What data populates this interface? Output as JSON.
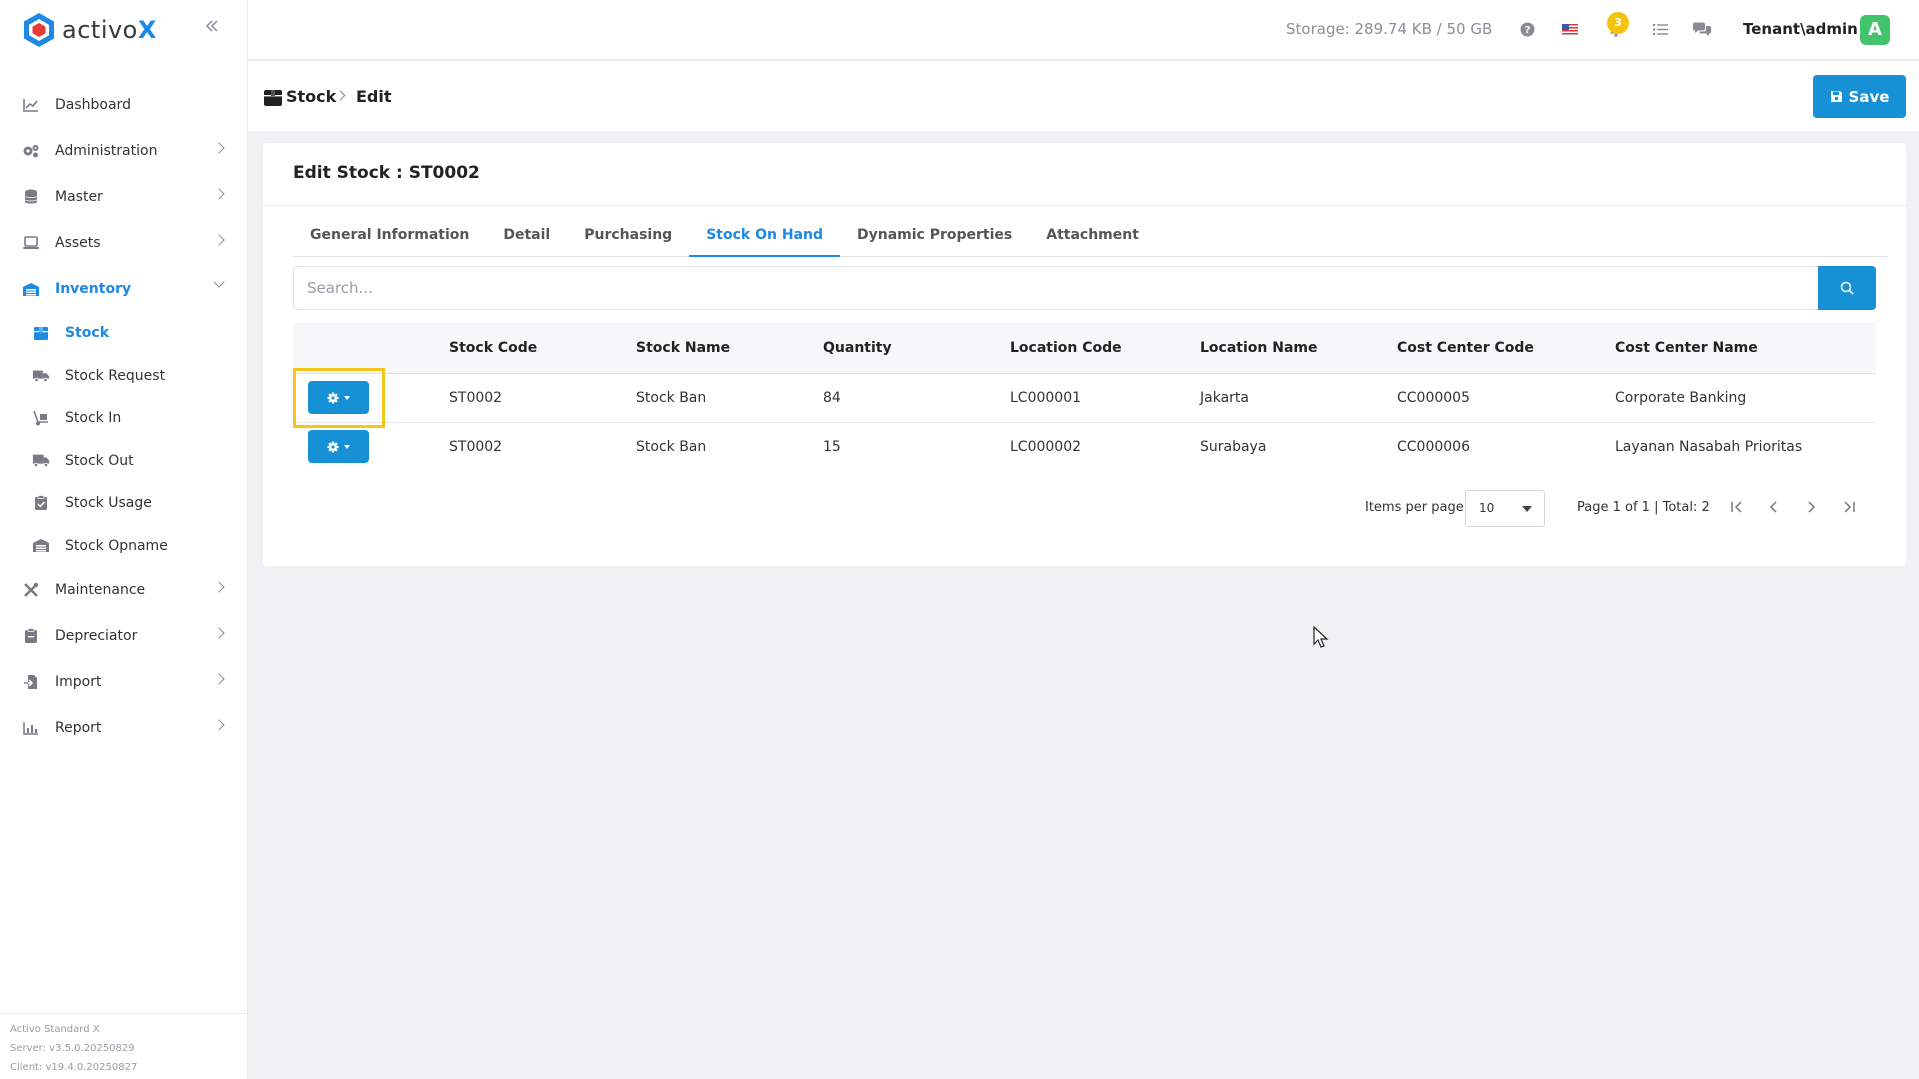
{
  "app": {
    "logo_text_main": "activo",
    "logo_text_accent": "X",
    "footer": {
      "product": "Activo Standard X",
      "server": "Server: v3.5.0.20250829",
      "client": "Client: v19.4.0.20250827"
    }
  },
  "sidebar": {
    "items": [
      {
        "label": "Dashboard",
        "icon": "chart-line-icon"
      },
      {
        "label": "Administration",
        "icon": "gears-icon"
      },
      {
        "label": "Master",
        "icon": "database-icon"
      },
      {
        "label": "Assets",
        "icon": "laptop-icon"
      },
      {
        "label": "Inventory",
        "icon": "warehouse-icon"
      },
      {
        "label": "Maintenance",
        "icon": "tools-icon"
      },
      {
        "label": "Depreciator",
        "icon": "clipboard-icon"
      },
      {
        "label": "Import",
        "icon": "file-import-icon"
      },
      {
        "label": "Report",
        "icon": "bar-chart-icon"
      }
    ],
    "inventory_sub": [
      {
        "label": "Stock",
        "icon": "box-icon"
      },
      {
        "label": "Stock Request",
        "icon": "truck-icon"
      },
      {
        "label": "Stock In",
        "icon": "dolly-icon"
      },
      {
        "label": "Stock Out",
        "icon": "truck-moving-icon"
      },
      {
        "label": "Stock Usage",
        "icon": "clipboard-check-icon"
      },
      {
        "label": "Stock Opname",
        "icon": "warehouse-icon"
      }
    ]
  },
  "topbar": {
    "storage": "Storage: 289.74 KB / 50 GB",
    "notification_count": "3",
    "tenant": "Tenant\\admin",
    "avatar_letter": "A"
  },
  "breadcrumb": {
    "root": "Stock",
    "current": "Edit"
  },
  "toolbar": {
    "save_label": "Save"
  },
  "card": {
    "title": "Edit Stock : ST0002",
    "tabs": [
      "General Information",
      "Detail",
      "Purchasing",
      "Stock On Hand",
      "Dynamic Properties",
      "Attachment"
    ],
    "active_tab": "Stock On Hand",
    "search_placeholder": "Search...",
    "columns": [
      "Stock Code",
      "Stock Name",
      "Quantity",
      "Location Code",
      "Location Name",
      "Cost Center Code",
      "Cost Center Name"
    ],
    "rows": [
      [
        "ST0002",
        "Stock Ban",
        "84",
        "LC000001",
        "Jakarta",
        "CC000005",
        "Corporate Banking"
      ],
      [
        "ST0002",
        "Stock Ban",
        "15",
        "LC000002",
        "Surabaya",
        "CC000006",
        "Layanan Nasabah Prioritas"
      ]
    ]
  },
  "pager": {
    "items_per_page_label": "Items per page",
    "items_per_page": "10",
    "page_info": "Page 1 of 1 | Total: 2"
  },
  "colors": {
    "primary": "#1791d6",
    "highlight": "#f5c518",
    "badge": "#f4c20d",
    "avatar": "#43c36b"
  }
}
